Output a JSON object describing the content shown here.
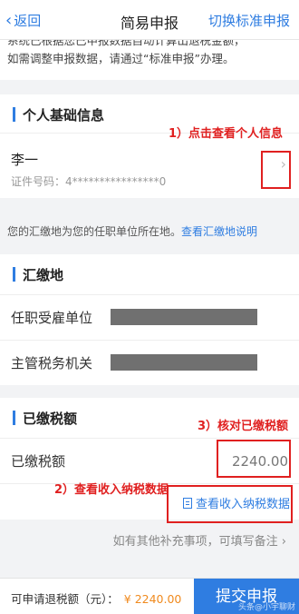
{
  "nav": {
    "back_label": "返回",
    "title": "简易申报",
    "switch_label": "切换标准申报"
  },
  "notice": {
    "line1": "系统已根据您已申报数据自动计算出退税金额，",
    "line2": "如需调整申报数据，请通过“标准申报”办理。"
  },
  "personal": {
    "section_title": "个人基础信息",
    "name": "李一",
    "cert_label": "证件号码：",
    "cert_value": "4****************0"
  },
  "payment_hint": {
    "text": "您的汇缴地为您的任职单位所在地。",
    "link": "查看汇缴地说明"
  },
  "payment_location": {
    "section_title": "汇缴地",
    "employer_label": "任职受雇单位",
    "tax_office_label": "主管税务机关"
  },
  "paid_tax": {
    "section_title": "已缴税额",
    "label": "已缴税额",
    "value": "2240.00",
    "income_link": "查看收入纳税数据"
  },
  "remark": {
    "text": "如有其他补充事项，可填写备注"
  },
  "footer": {
    "refund_label": "可申请退税额（元）：",
    "refund_amount": "¥ 2240.00",
    "submit_label": "提交申报",
    "watermark": "头条@小宇聊财"
  },
  "annotations": {
    "a1": "1）点击查看个人信息",
    "a2": "2）查看收入纳税数据",
    "a3": "3）核对已缴税额"
  },
  "colors": {
    "accent": "#2f7de1",
    "annotation": "#e02020",
    "amount": "#f08a1e"
  }
}
